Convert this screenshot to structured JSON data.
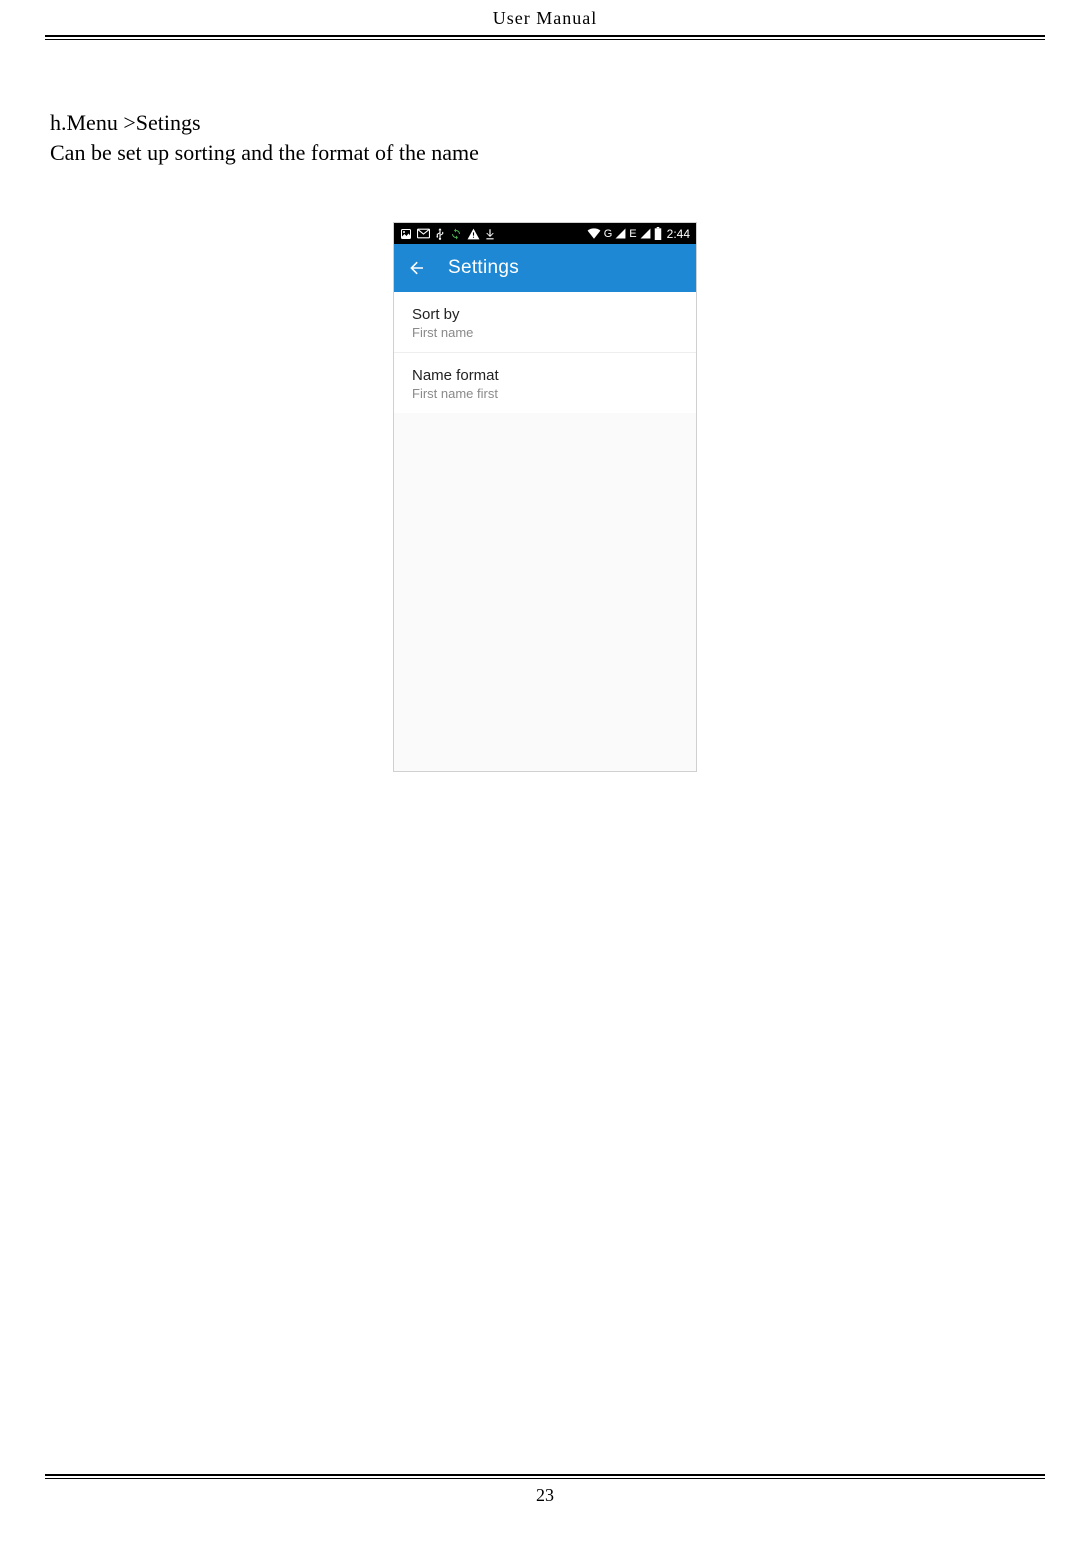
{
  "page": {
    "header_title": "User    Manual",
    "number": "23"
  },
  "section": {
    "heading": "h.Menu >Setings",
    "description": "Can be set up sorting and the format of the name"
  },
  "phone": {
    "status": {
      "time": "2:44",
      "network_g": "G",
      "network_e": "E"
    },
    "appbar": {
      "title": "Settings"
    },
    "items": [
      {
        "title": "Sort by",
        "subtitle": "First name"
      },
      {
        "title": "Name format",
        "subtitle": "First name first"
      }
    ]
  }
}
